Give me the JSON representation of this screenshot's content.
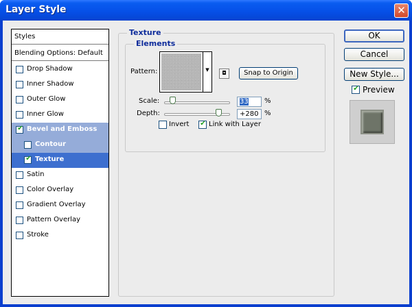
{
  "window": {
    "title": "Layer Style",
    "close_glyph": "✕"
  },
  "styles_panel": {
    "header": "Styles",
    "blending_options": "Blending Options: Default",
    "items": [
      {
        "label": "Drop Shadow",
        "checked": false
      },
      {
        "label": "Inner Shadow",
        "checked": false
      },
      {
        "label": "Outer Glow",
        "checked": false
      },
      {
        "label": "Inner Glow",
        "checked": false
      },
      {
        "label": "Bevel and Emboss",
        "checked": true
      },
      {
        "label": "Contour",
        "checked": false
      },
      {
        "label": "Texture",
        "checked": true
      },
      {
        "label": "Satin",
        "checked": false
      },
      {
        "label": "Color Overlay",
        "checked": false
      },
      {
        "label": "Gradient Overlay",
        "checked": false
      },
      {
        "label": "Pattern Overlay",
        "checked": false
      },
      {
        "label": "Stroke",
        "checked": false
      }
    ]
  },
  "texture": {
    "group_title": "Texture",
    "elements_title": "Elements",
    "pattern_label": "Pattern:",
    "snap_label": "Snap to Origin",
    "scale": {
      "label": "Scale:",
      "value": "33",
      "unit": "%",
      "level": 0.1
    },
    "depth": {
      "label": "Depth:",
      "value": "+280",
      "unit": "%",
      "level": 0.82
    },
    "invert": {
      "label": "Invert",
      "checked": false
    },
    "link": {
      "label": "Link with Layer",
      "checked": true
    }
  },
  "buttons": {
    "ok": "OK",
    "cancel": "Cancel",
    "new_style": "New Style..."
  },
  "preview": {
    "label": "Preview",
    "checked": true
  },
  "colors": {
    "titlebar": "#0650e8",
    "selected": "#3d6fcf",
    "highlight": "#95acd9",
    "group_title": "#0e2c9b"
  }
}
